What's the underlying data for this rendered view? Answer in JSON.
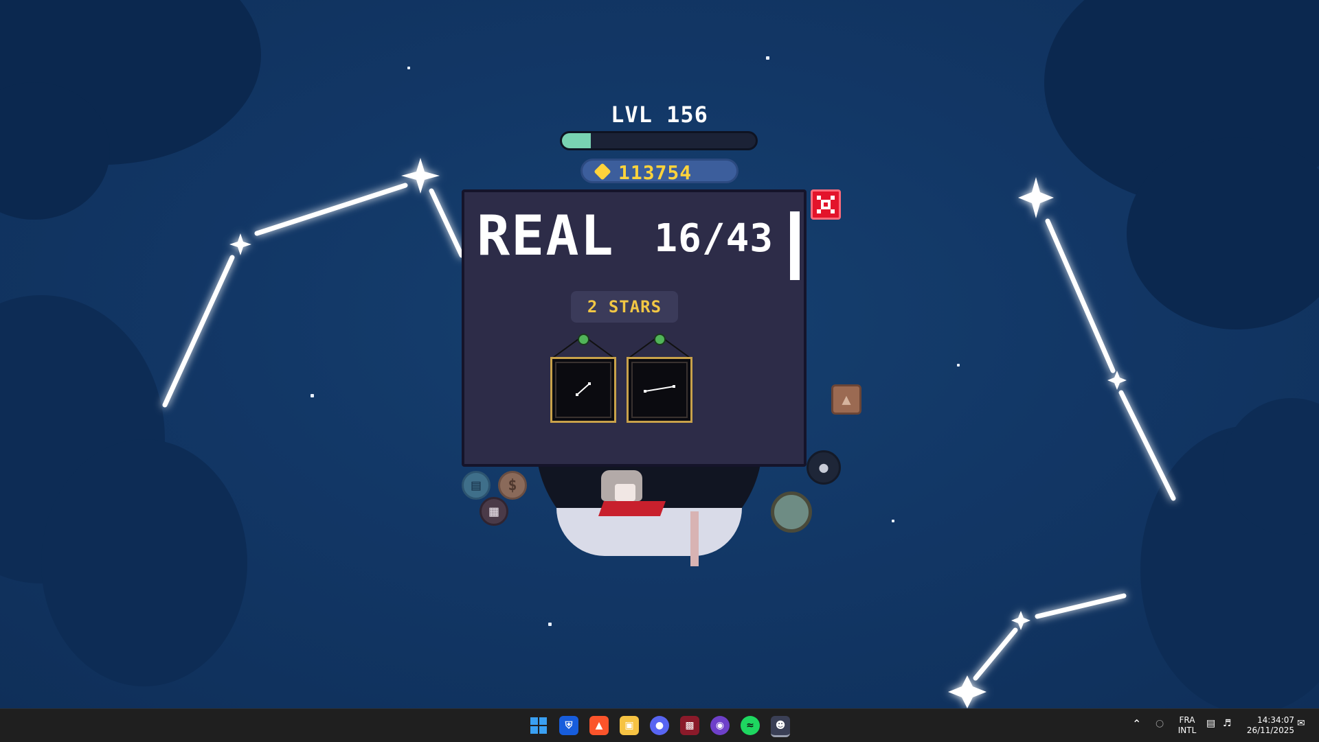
{
  "hud": {
    "level_label": "LVL 156",
    "xp_progress": 0.15,
    "coins": "113754"
  },
  "modal": {
    "title": "REAL",
    "count": "16/43",
    "stars_label": "2 STARS",
    "frames": [
      {
        "name": "constellation-frame-1"
      },
      {
        "name": "constellation-frame-2"
      }
    ]
  },
  "colors": {
    "sky": "#123766",
    "modal_bg": "#2d2c48",
    "close_red": "#e3142b",
    "coin_gold": "#ffd33b",
    "xp_green": "#79d3b2"
  },
  "taskbar": {
    "apps": [
      "windows-start",
      "bitwarden",
      "brave",
      "file-explorer",
      "discord",
      "remote-desktop",
      "github",
      "spotify",
      "game"
    ],
    "lang_line1": "FRA",
    "lang_line2": "INTL",
    "time": "14:34:07",
    "date": "26/11/2025"
  }
}
